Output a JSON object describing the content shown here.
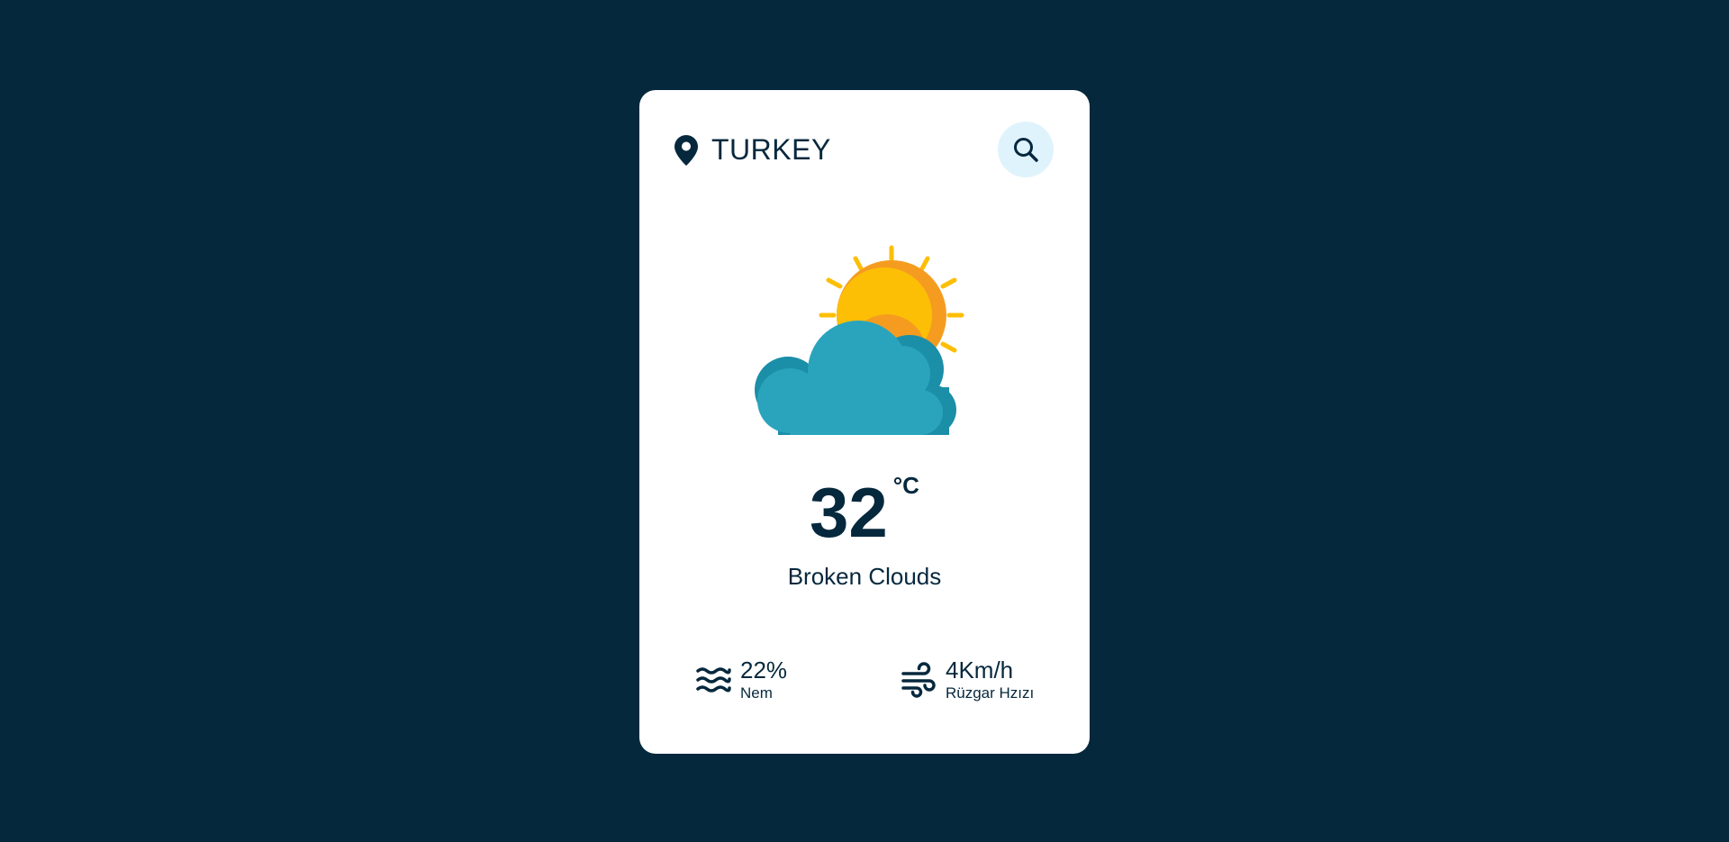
{
  "location": {
    "name": "TURKEY",
    "icon": "location-pin-icon"
  },
  "search": {
    "icon": "search-icon"
  },
  "weather": {
    "icon": "sun-behind-cloud-icon",
    "temperature": "32",
    "unit": "°C",
    "description": "Broken Clouds"
  },
  "details": {
    "humidity": {
      "icon": "water-waves-icon",
      "value": "22%",
      "label": "Nem"
    },
    "wind": {
      "icon": "wind-icon",
      "value": "4Km/h",
      "label": "Rüzgar Hzızı"
    }
  },
  "colors": {
    "background": "#06283d",
    "card": "#ffffff",
    "text": "#06283d",
    "search_bg": "#dff3fc",
    "sun": "#fcbf06",
    "sun_shade": "#f59c20",
    "cloud": "#2aa4bc",
    "cloud_shade": "#1b8ea8"
  }
}
